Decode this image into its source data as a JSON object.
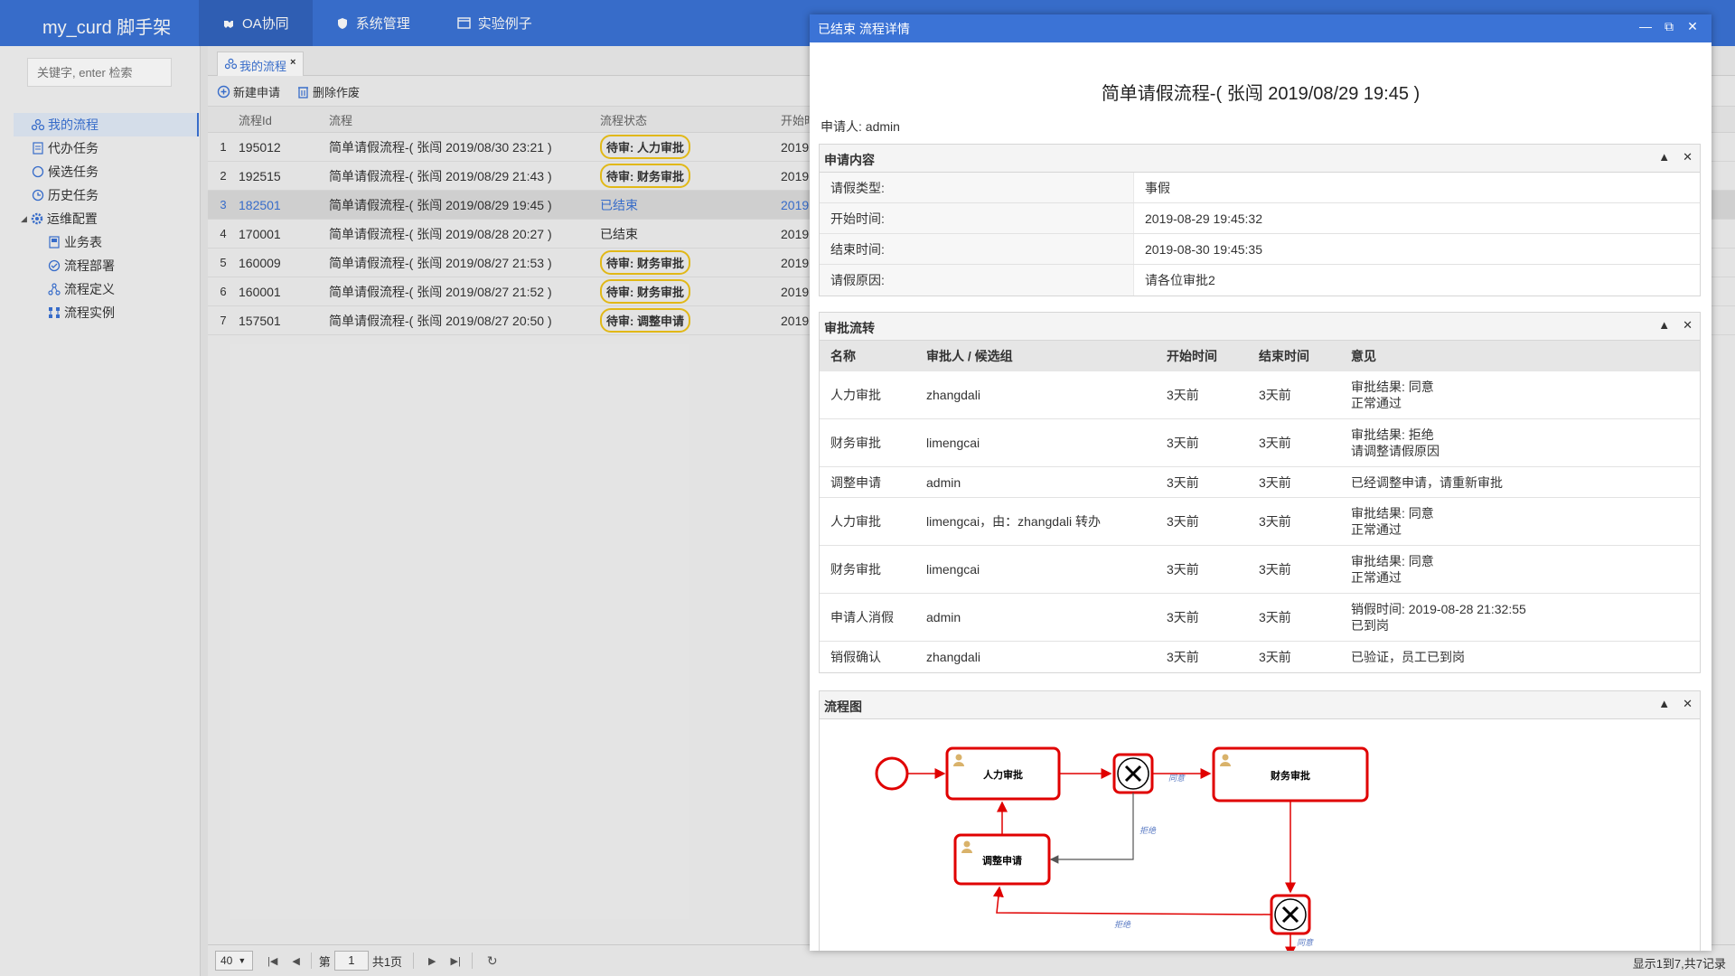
{
  "app": {
    "brand": "my_curd 脚手架"
  },
  "topnav": [
    "OA协同",
    "系统管理",
    "实验例子"
  ],
  "sidebar": {
    "search_placeholder": "关键字, enter 检索",
    "items": [
      {
        "label": "我的流程",
        "icon": "flow-icon"
      },
      {
        "label": "代办任务",
        "icon": "doc-icon"
      },
      {
        "label": "候选任务",
        "icon": "circle-icon"
      },
      {
        "label": "历史任务",
        "icon": "clock-icon"
      },
      {
        "label": "运维配置",
        "icon": "gear-icon"
      },
      {
        "label": "业务表",
        "icon": "table-icon"
      },
      {
        "label": "流程部署",
        "icon": "deploy-icon"
      },
      {
        "label": "流程定义",
        "icon": "definition-icon"
      },
      {
        "label": "流程实例",
        "icon": "instance-icon"
      }
    ]
  },
  "tab": {
    "label": "我的流程",
    "close": "×"
  },
  "toolbar": {
    "new_label": "新建申请",
    "delete_label": "删除作废"
  },
  "grid": {
    "headers": [
      "流程Id",
      "流程",
      "流程状态",
      "开始时"
    ],
    "rows": [
      {
        "no": "1",
        "id": "195012",
        "name": "简单请假流程-( 张闯 2019/08/30 23:21 )",
        "status": "待审: 人力审批",
        "start": "2019"
      },
      {
        "no": "2",
        "id": "192515",
        "name": "简单请假流程-( 张闯 2019/08/29 21:43 )",
        "status": "待审: 财务审批",
        "start": "2019"
      },
      {
        "no": "3",
        "id": "182501",
        "name": "简单请假流程-( 张闯 2019/08/29 19:45 )",
        "status": "已结束",
        "start": "2019"
      },
      {
        "no": "4",
        "id": "170001",
        "name": "简单请假流程-( 张闯 2019/08/28 20:27 )",
        "status": "已结束",
        "start": "2019"
      },
      {
        "no": "5",
        "id": "160009",
        "name": "简单请假流程-( 张闯 2019/08/27 21:53 )",
        "status": "待审: 财务审批",
        "start": "2019"
      },
      {
        "no": "6",
        "id": "160001",
        "name": "简单请假流程-( 张闯 2019/08/27 21:52 )",
        "status": "待审: 财务审批",
        "start": "2019"
      },
      {
        "no": "7",
        "id": "157501",
        "name": "简单请假流程-( 张闯 2019/08/27 20:50 )",
        "status": "待审: 调整申请",
        "start": "2019"
      }
    ]
  },
  "pager": {
    "page_size": "40",
    "page_prefix": "第",
    "page_value": "1",
    "page_total": "共1页",
    "info": "显示1到7,共7记录"
  },
  "dialog": {
    "title": "已结束 流程详情",
    "heading": "简单请假流程-( 张闯 2019/08/29 19:45 )",
    "applicant": "申请人: admin",
    "apply_panel": {
      "title": "申请内容",
      "rows": [
        {
          "k": "请假类型:",
          "v": "事假"
        },
        {
          "k": "开始时间:",
          "v": "2019-08-29 19:45:32"
        },
        {
          "k": "结束时间:",
          "v": "2019-08-30 19:45:35"
        },
        {
          "k": "请假原因:",
          "v": "请各位审批2"
        }
      ]
    },
    "approval_panel": {
      "title": "审批流转",
      "headers": [
        "名称",
        "审批人 / 候选组",
        "开始时间",
        "结束时间",
        "意见"
      ],
      "rows": [
        {
          "name": "人力审批",
          "who": "zhangdali",
          "start": "3天前",
          "end": "3天前",
          "note1": "审批结果: 同意",
          "note2": "正常通过"
        },
        {
          "name": "财务审批",
          "who": "limengcai",
          "start": "3天前",
          "end": "3天前",
          "note1": "审批结果: 拒绝",
          "note2": "请调整请假原因"
        },
        {
          "name": "调整申请",
          "who": "admin",
          "start": "3天前",
          "end": "3天前",
          "note1": "已经调整申请，请重新审批",
          "note2": ""
        },
        {
          "name": "人力审批",
          "who": "limengcai，由：zhangdali 转办",
          "start": "3天前",
          "end": "3天前",
          "note1": "审批结果: 同意",
          "note2": "正常通过"
        },
        {
          "name": "财务审批",
          "who": "limengcai",
          "start": "3天前",
          "end": "3天前",
          "note1": "审批结果: 同意",
          "note2": "正常通过"
        },
        {
          "name": "申请人消假",
          "who": "admin",
          "start": "3天前",
          "end": "3天前",
          "note1": "销假时间: 2019-08-28 21:32:55",
          "note2": "已到岗"
        },
        {
          "name": "销假确认",
          "who": "zhangdali",
          "start": "3天前",
          "end": "3天前",
          "note1": "已验证，员工已到岗",
          "note2": ""
        }
      ]
    },
    "diagram_panel": {
      "title": "流程图",
      "nodes": {
        "hr": "人力审批",
        "finance": "财务审批",
        "adjust": "调整申请"
      },
      "edge_labels": {
        "agree1": "同意",
        "reject1": "拒绝",
        "reject2": "拒绝",
        "agree2": "同意"
      },
      "accent": "#e00000"
    }
  }
}
